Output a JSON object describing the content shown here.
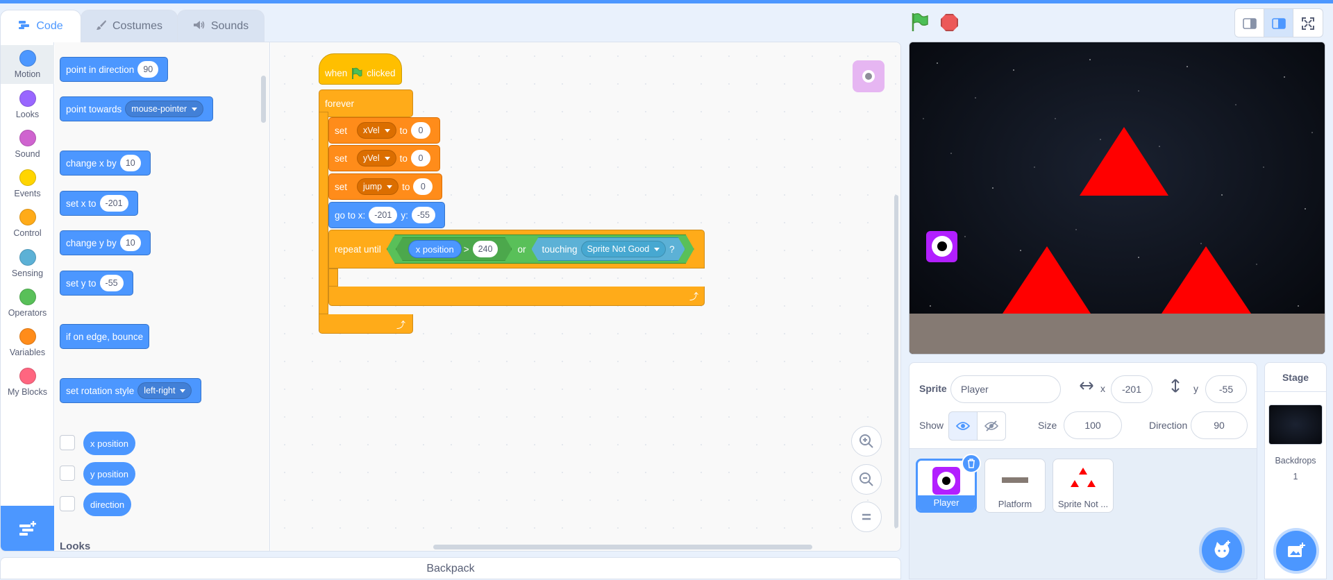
{
  "tabs": [
    {
      "label": "Code",
      "icon": "code-icon",
      "active": true
    },
    {
      "label": "Costumes",
      "icon": "brush-icon",
      "active": false
    },
    {
      "label": "Sounds",
      "icon": "speaker-icon",
      "active": false
    }
  ],
  "categories": [
    {
      "label": "Motion",
      "color": "#4c97ff"
    },
    {
      "label": "Looks",
      "color": "#9966ff"
    },
    {
      "label": "Sound",
      "color": "#cf63cf"
    },
    {
      "label": "Events",
      "color": "#ffd500"
    },
    {
      "label": "Control",
      "color": "#ffab19"
    },
    {
      "label": "Sensing",
      "color": "#5cb1d6"
    },
    {
      "label": "Operators",
      "color": "#59c059"
    },
    {
      "label": "Variables",
      "color": "#ff8c1a"
    },
    {
      "label": "My Blocks",
      "color": "#ff6680"
    }
  ],
  "palette": {
    "point_in_direction": {
      "label": "point in direction",
      "value": "90"
    },
    "point_towards": {
      "label": "point towards",
      "value": "mouse-pointer"
    },
    "change_x": {
      "label": "change x by",
      "value": "10"
    },
    "set_x": {
      "label": "set x to",
      "value": "-201"
    },
    "change_y": {
      "label": "change y by",
      "value": "10"
    },
    "set_y": {
      "label": "set y to",
      "value": "-55"
    },
    "bounce": {
      "label": "if on edge, bounce"
    },
    "rotation_style": {
      "label": "set rotation style",
      "value": "left-right"
    },
    "reporters": [
      "x position",
      "y position",
      "direction"
    ],
    "next_section": "Looks"
  },
  "script": {
    "hat": {
      "when": "when",
      "clicked": "clicked"
    },
    "forever": "forever",
    "set_label": "set",
    "to_label": "to",
    "vars": [
      {
        "name": "xVel",
        "value": "0"
      },
      {
        "name": "yVel",
        "value": "0"
      },
      {
        "name": "jump",
        "value": "0"
      }
    ],
    "goto": {
      "label": "go to x:",
      "x": "-201",
      "y_label": "y:",
      "y": "-55"
    },
    "repeat_until": {
      "label": "repeat until",
      "reporter": "x position",
      "op": ">",
      "compare": "240",
      "or": "or",
      "touching": "touching",
      "touching_target": "Sprite Not Good",
      "q": "?"
    }
  },
  "backpack": "Backpack",
  "sprite_info": {
    "sprite_label": "Sprite",
    "sprite_name": "Player",
    "x_label": "x",
    "x": "-201",
    "y_label": "y",
    "y": "-55",
    "show_label": "Show",
    "size_label": "Size",
    "size": "100",
    "direction_label": "Direction",
    "direction": "90"
  },
  "sprites": [
    {
      "name": "Player",
      "selected": true
    },
    {
      "name": "Platform",
      "selected": false
    },
    {
      "name": "Sprite Not ...",
      "selected": false
    }
  ],
  "stage_panel": {
    "title": "Stage",
    "backdrops_label": "Backdrops",
    "backdrops_count": "1"
  },
  "colors": {
    "accent": "#4c97ff",
    "motion": "#4c97ff",
    "control": "#ffab19",
    "events": "#ffbf00",
    "variables": "#ff8c1a",
    "operators": "#59c059",
    "sensing": "#5cb1d6",
    "player": "#b21fff",
    "hazard": "#ff0000"
  }
}
